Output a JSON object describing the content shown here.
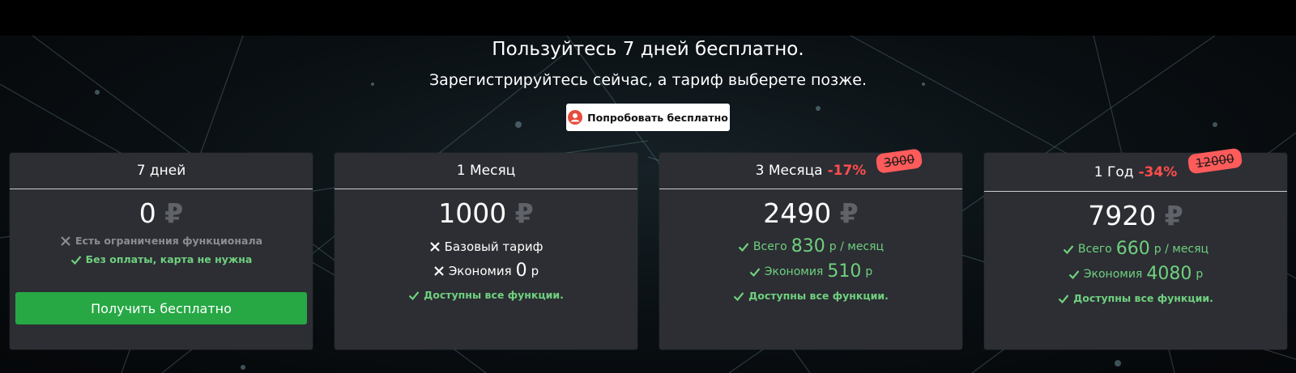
{
  "hero": {
    "heading": "Пользуйтесь 7 дней бесплатно.",
    "subheading": "Зарегистрируйтесь сейчас, а тариф выберете позже.",
    "try_button": "Попробовать бесплатно"
  },
  "currency_symbol": "₽",
  "plans": [
    {
      "title": "7 дней",
      "price": "0",
      "features": [
        {
          "icon": "cross-icon",
          "text": "Есть ограничения функционала"
        },
        {
          "icon": "check-icon",
          "text": "Без оплаты, карта не нужна"
        }
      ],
      "button": "Получить бесплатно"
    },
    {
      "title": "1 Месяц",
      "price": "1000",
      "features": [
        {
          "icon": "cross-icon",
          "text": "Базовый тариф"
        },
        {
          "icon": "cross-icon",
          "prefix": "Экономия",
          "value": "0",
          "unit": "р"
        },
        {
          "icon": "check-icon",
          "text": "Доступны все функции."
        }
      ]
    },
    {
      "title": "3 Месяца",
      "discount": "-17%",
      "old_price": "3000",
      "price": "2490",
      "features": [
        {
          "icon": "check-icon",
          "prefix": "Всего",
          "value": "830",
          "unit": "р / месяц"
        },
        {
          "icon": "check-icon",
          "prefix": "Экономия",
          "value": "510",
          "unit": "р"
        },
        {
          "icon": "check-icon",
          "text": "Доступны все функции."
        }
      ]
    },
    {
      "title": "1 Год",
      "discount": "-34%",
      "old_price": "12000",
      "price": "7920",
      "features": [
        {
          "icon": "check-icon",
          "prefix": "Всего",
          "value": "660",
          "unit": "р / месяц"
        },
        {
          "icon": "check-icon",
          "prefix": "Экономия",
          "value": "4080",
          "unit": "р"
        },
        {
          "icon": "check-icon",
          "text": "Доступны все функции."
        }
      ]
    }
  ],
  "colors": {
    "accent_green": "#27a845",
    "feature_green": "#6fd07f",
    "discount_red": "#ff4d4d",
    "card_bg": "#2c2e33"
  }
}
